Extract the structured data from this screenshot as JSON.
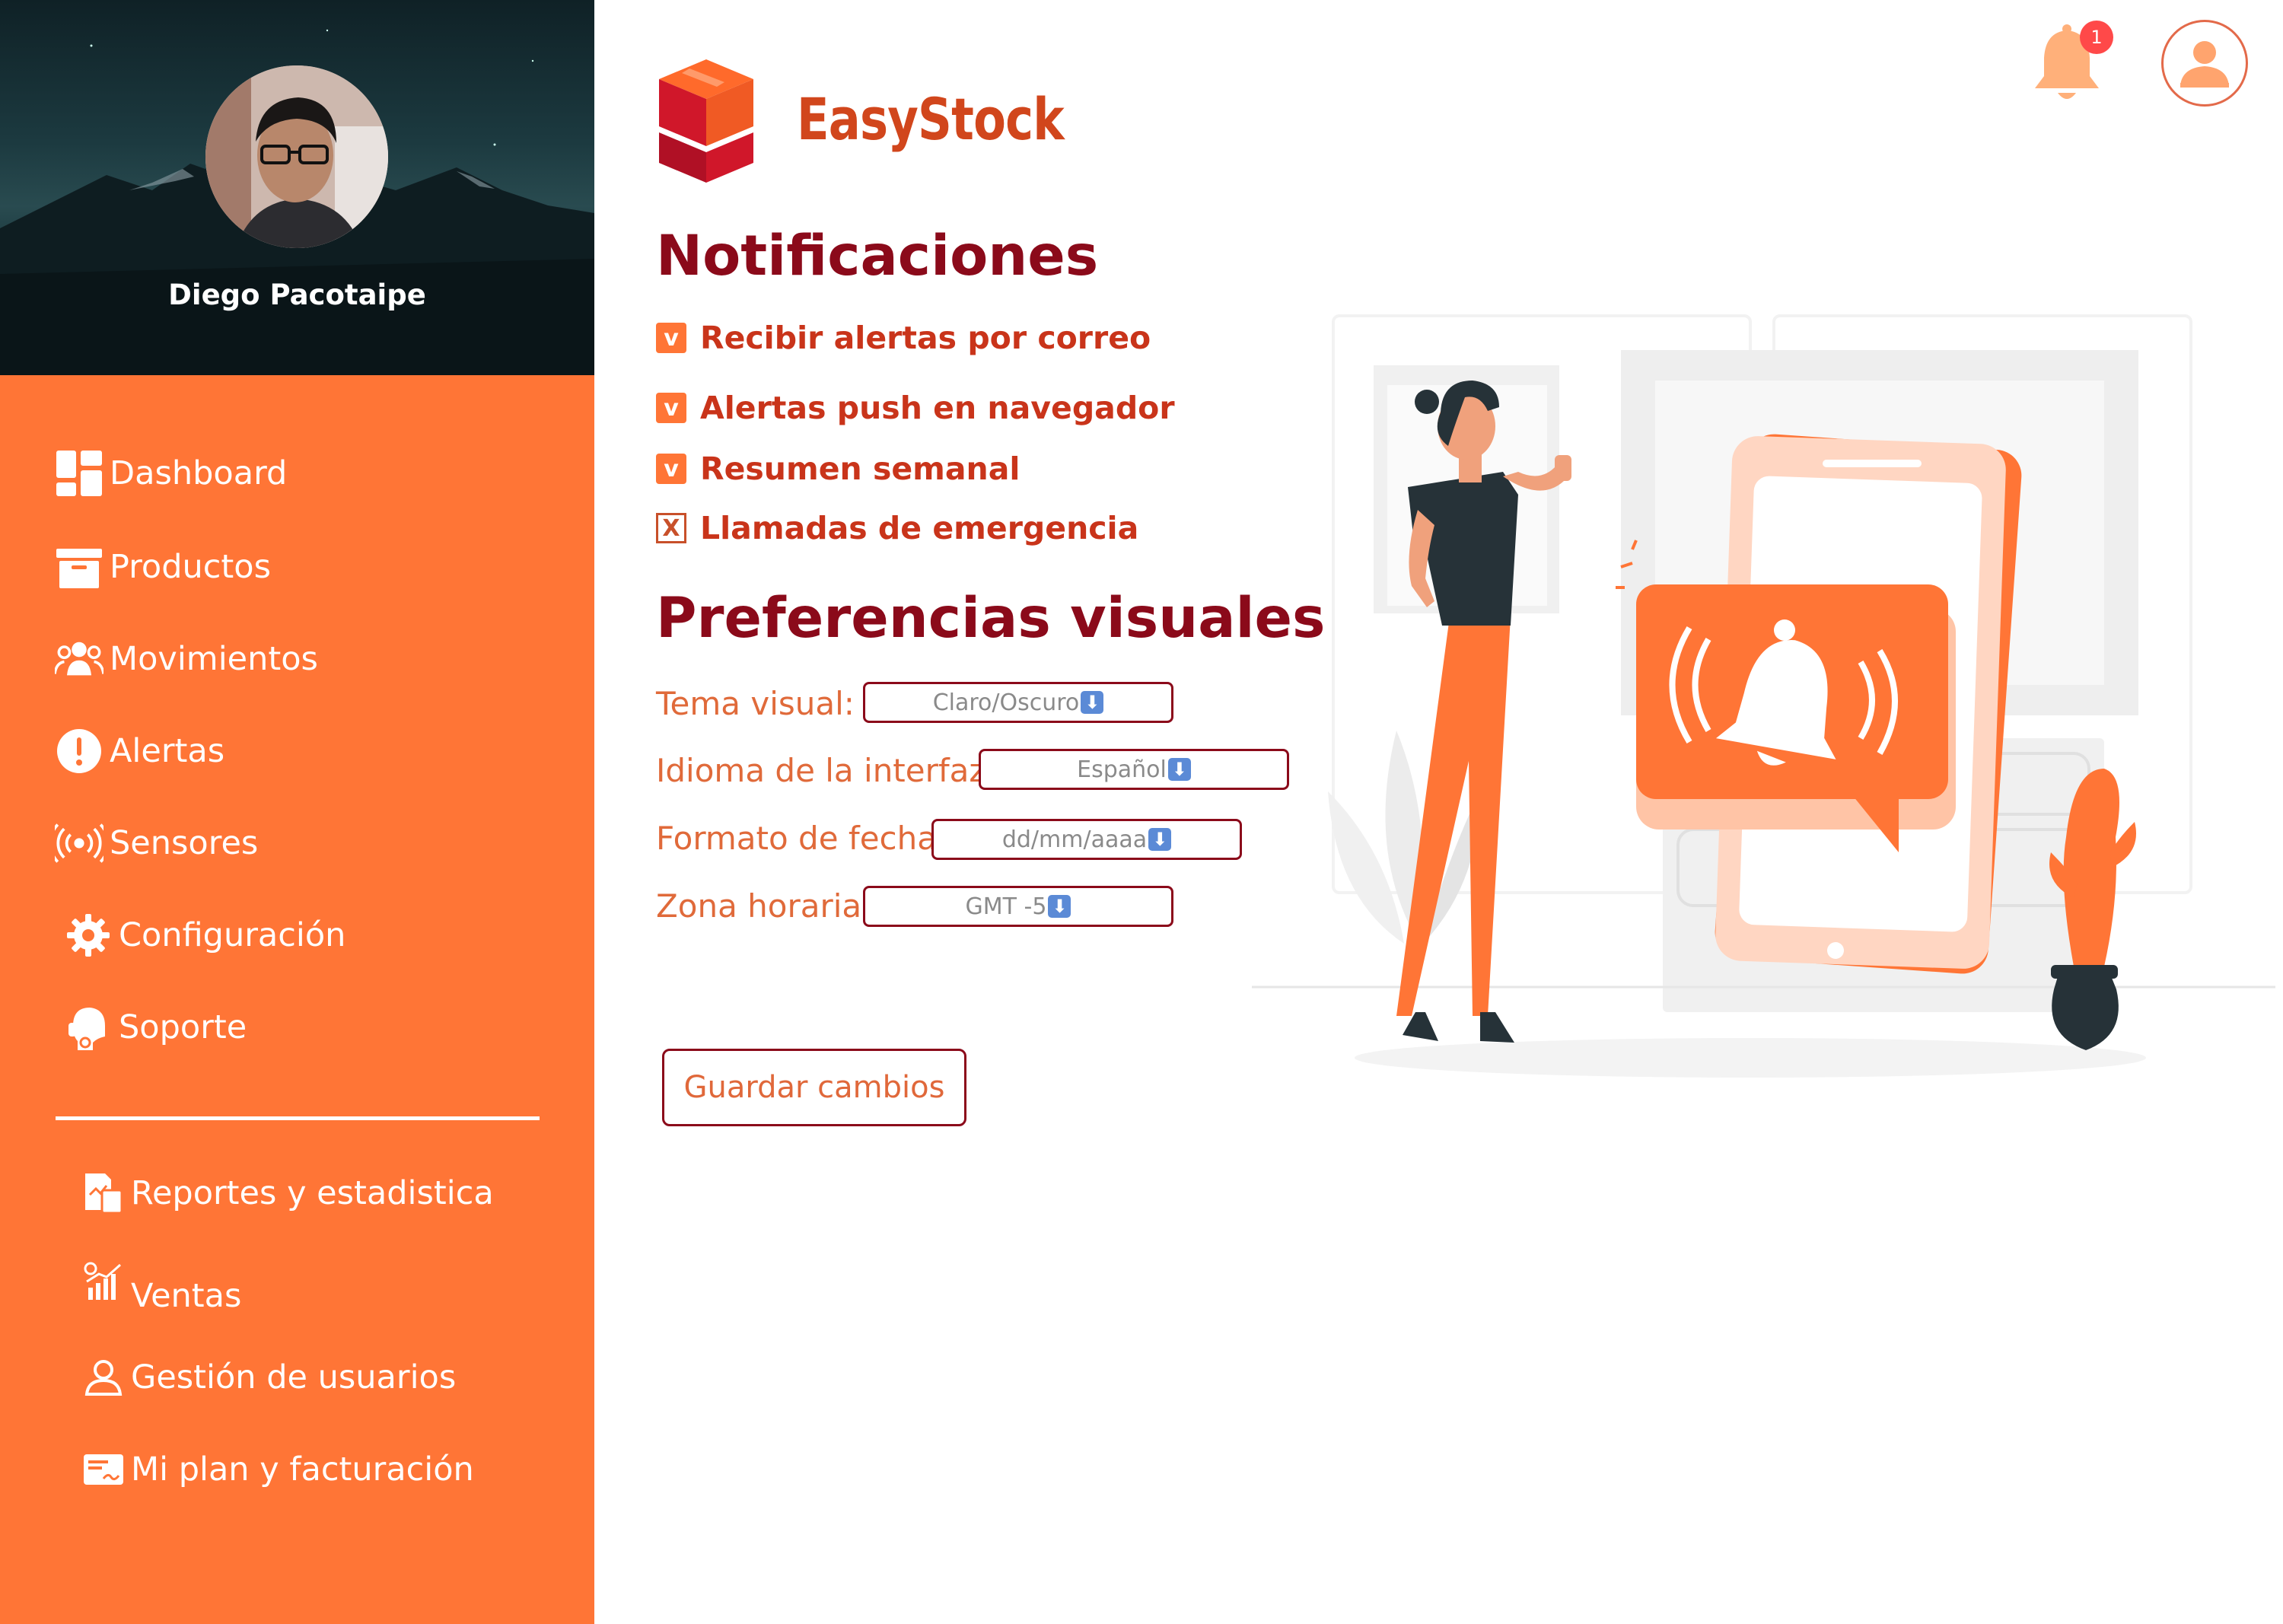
{
  "sidebar": {
    "user_name": "Diego Pacotaipe",
    "nav": [
      {
        "label": "Dashboard",
        "icon": "dashboard-icon"
      },
      {
        "label": "Productos",
        "icon": "box-icon"
      },
      {
        "label": "Movimientos",
        "icon": "users-group-icon"
      },
      {
        "label": "Alertas",
        "icon": "alert-icon"
      },
      {
        "label": "Sensores",
        "icon": "broadcast-icon"
      },
      {
        "label": "Configuración",
        "icon": "gear-icon"
      },
      {
        "label": "Soporte",
        "icon": "headset-icon"
      }
    ],
    "secondary": [
      {
        "label": "Reportes y estadistica",
        "icon": "report-icon"
      },
      {
        "label": "Ventas",
        "icon": "sales-chart-icon"
      },
      {
        "label": "Gestión de usuarios",
        "icon": "user-manage-icon"
      },
      {
        "label": "Mi plan y facturación",
        "icon": "billing-icon"
      }
    ]
  },
  "header": {
    "brand": "EasyStock",
    "notification_count": "1"
  },
  "notifications": {
    "title": "Notificaciones",
    "options": [
      {
        "mark": "v",
        "label": "Recibir alertas por correo",
        "checked": true
      },
      {
        "mark": "v",
        "label": "Alertas push en navegador",
        "checked": true
      },
      {
        "mark": "v",
        "label": "Resumen semanal",
        "checked": true
      },
      {
        "mark": "X",
        "label": "Llamadas de emergencia",
        "checked": false
      }
    ]
  },
  "visual_prefs": {
    "title": "Preferencias visuales",
    "fields": [
      {
        "label": "Tema visual:",
        "value": "Claro/Oscuro"
      },
      {
        "label": "Idioma de la interfaz:",
        "value": "Español"
      },
      {
        "label": "Formato de fecha:",
        "value": "dd/mm/aaaa"
      },
      {
        "label": "Zona horaria:",
        "value": "GMT -5"
      }
    ]
  },
  "actions": {
    "save": "Guardar cambios"
  },
  "colors": {
    "accent": "#ff7536",
    "heading": "#8b0a1a",
    "text_orange": "#e06a3a"
  }
}
